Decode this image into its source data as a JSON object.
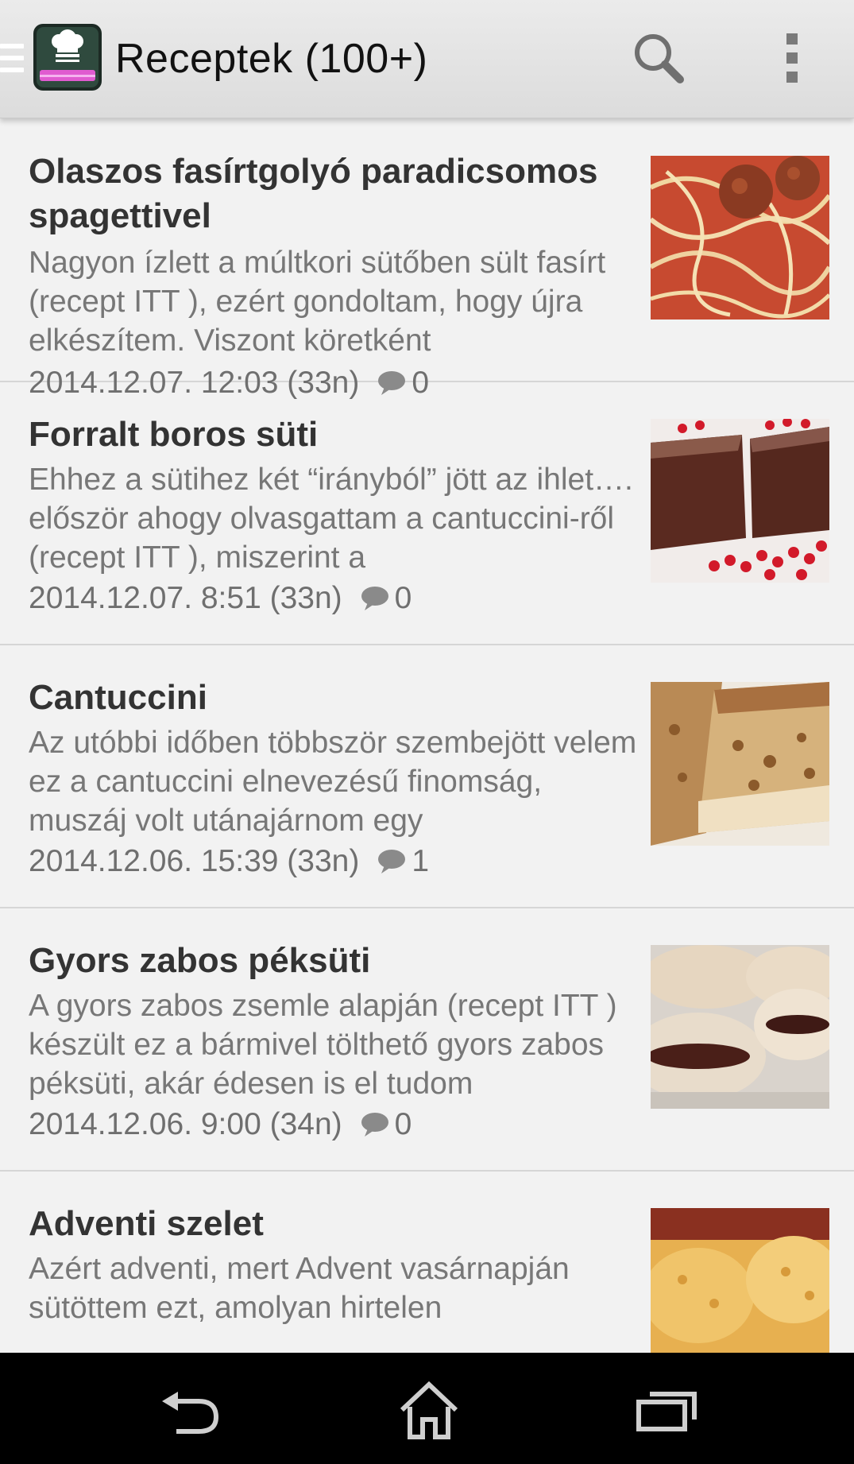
{
  "actionbar": {
    "title": "Receptek (100+)",
    "logo_icon": "chef-hat-book-icon",
    "search_icon": "search-icon",
    "overflow_icon": "overflow-menu-icon"
  },
  "colors": {
    "actionbar": "#e3e3e3",
    "background": "#f2f2f2",
    "title_text": "#333333",
    "excerpt_text": "#777777",
    "divider": "#d6d6d6",
    "logo_accent": "#e05bd0"
  },
  "posts": [
    {
      "title": "Olaszos fasírtgolyó paradicsomos spagettivel",
      "excerpt": "Nagyon ízlett a múltkori sütőben sült fasírt (recept ITT ), ezért gondoltam, hogy újra elkészítem. Viszont köretként",
      "date": "2014.12.07. 12:03 (33n)",
      "comments": "0",
      "image": "spaghetti-meatballs-photo"
    },
    {
      "title": "Forralt boros süti",
      "excerpt": "Ehhez a sütihez két “irányból” jött az ihlet…. először ahogy olvasgattam a cantuccini-ről (recept ITT ), miszerint a",
      "date": "2014.12.07. 8:51 (33n)",
      "comments": "0",
      "image": "mulled-wine-cake-photo"
    },
    {
      "title": "Cantuccini",
      "excerpt": "Az utóbbi időben többször szembejött velem ez a cantuccini elnevezésű finomság, muszáj volt utánajárnom egy",
      "date": "2014.12.06. 15:39 (33n)",
      "comments": "1",
      "image": "cantuccini-photo"
    },
    {
      "title": "Gyors zabos péksüti",
      "excerpt": "A gyors zabos zsemle alapján (recept ITT ) készült ez a bármivel tölthető gyors zabos péksüti, akár édesen is el tudom",
      "date": "2014.12.06. 9:00 (34n)",
      "comments": "0",
      "image": "oat-pastry-photo"
    },
    {
      "title": "Adventi szelet",
      "excerpt": "Azért adventi, mert Advent vasárnapján sütöttem ezt, amolyan hirtelen",
      "date": "",
      "comments": "",
      "image": "advent-slice-photo"
    }
  ],
  "navbar": {
    "back_icon": "back-icon",
    "home_icon": "home-icon",
    "recents_icon": "recent-apps-icon"
  }
}
